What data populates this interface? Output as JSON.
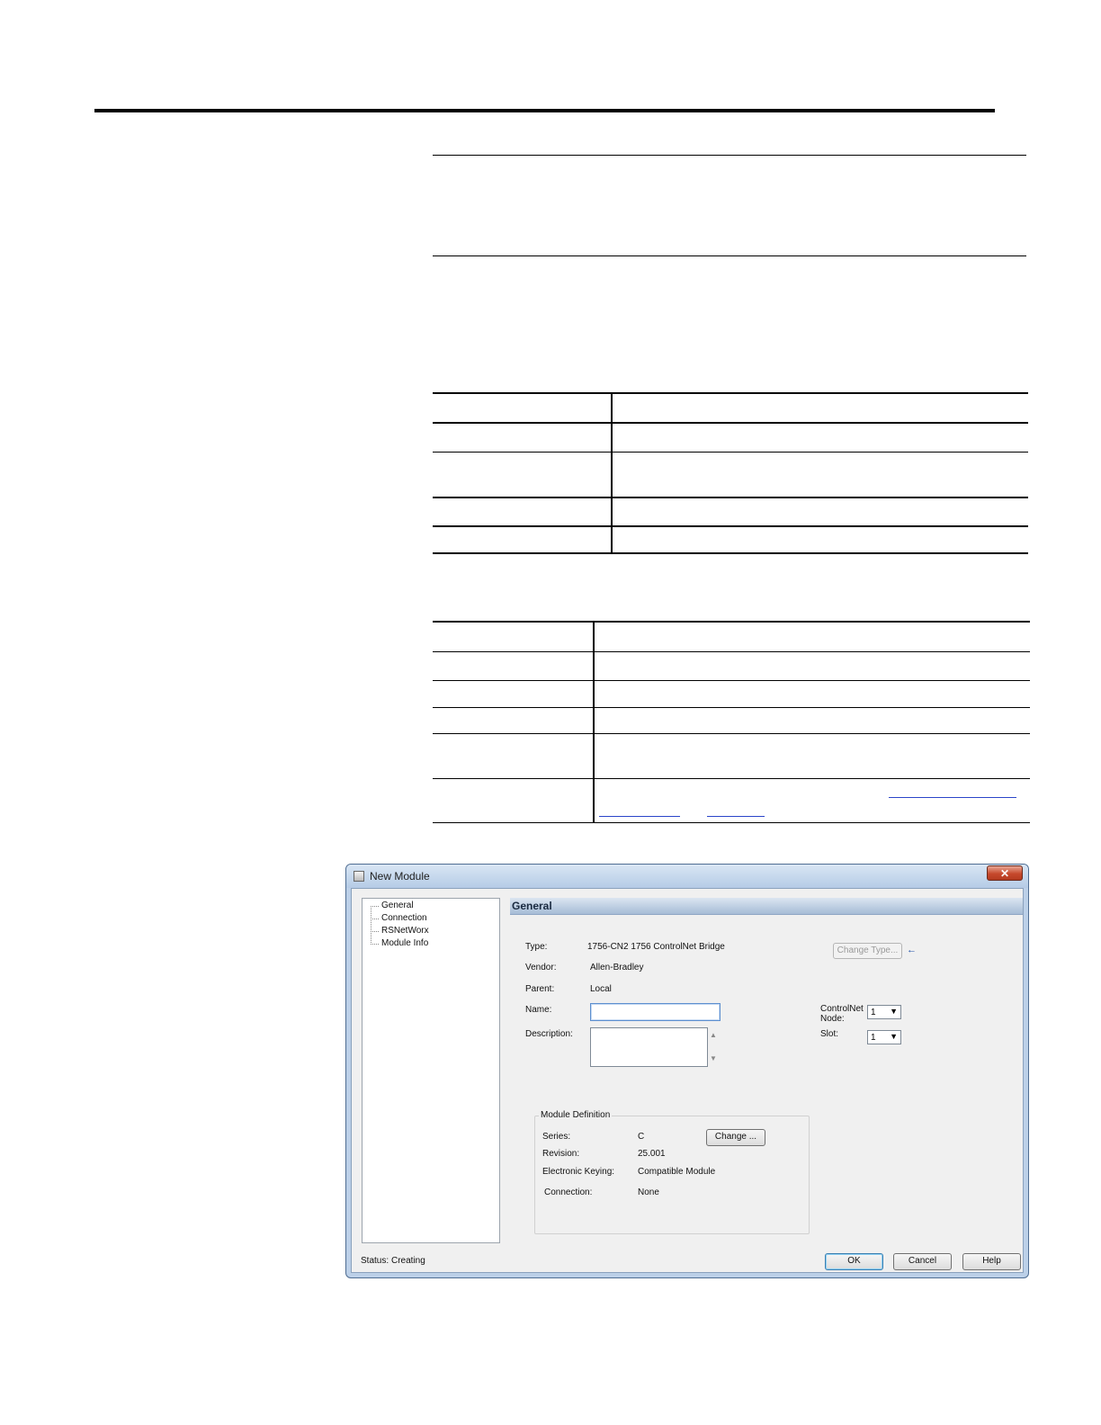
{
  "dialog": {
    "title": "New Module",
    "close_glyph": "✕",
    "tree": [
      "General",
      "Connection",
      "RSNetWorx",
      "Module Info"
    ],
    "section_title": "General",
    "fields": {
      "type_label": "Type:",
      "type_value": "1756-CN2 1756 ControlNet Bridge",
      "vendor_label": "Vendor:",
      "vendor_value": "Allen-Bradley",
      "parent_label": "Parent:",
      "parent_value": "Local",
      "name_label": "Name:",
      "name_value": "",
      "description_label": "Description:",
      "description_value": ""
    },
    "change_type_button": "Change Type...",
    "node_label": "ControlNet Node:",
    "node_value": "1",
    "slot_label": "Slot:",
    "slot_value": "1",
    "module_definition": {
      "title": "Module Definition",
      "series_label": "Series:",
      "series_value": "C",
      "revision_label": "Revision:",
      "revision_value": "25.001",
      "keying_label": "Electronic Keying:",
      "keying_value": "Compatible Module",
      "connection_label": "Connection:",
      "connection_value": "None",
      "change_button": "Change ..."
    },
    "status_label": "Status:",
    "status_value": "Creating",
    "buttons": {
      "ok": "OK",
      "cancel": "Cancel",
      "help": "Help"
    }
  },
  "colors": {
    "titlebar": "#c4d5ea",
    "close_button": "#c6492c",
    "client_background": "#f0f0f0"
  }
}
